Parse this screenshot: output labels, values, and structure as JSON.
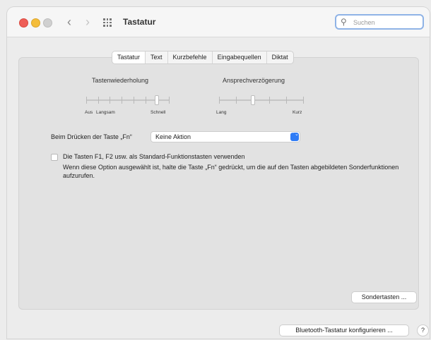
{
  "window": {
    "title": "Tastatur",
    "search_placeholder": "Suchen",
    "nav_back": "‹",
    "nav_forward": "›"
  },
  "tabs": [
    {
      "label": "Tastatur",
      "active": true
    },
    {
      "label": "Text",
      "active": false
    },
    {
      "label": "Kurzbefehle",
      "active": false
    },
    {
      "label": "Eingabequellen",
      "active": false
    },
    {
      "label": "Diktat",
      "active": false
    }
  ],
  "key_repeat": {
    "title": "Tastenwiederholung",
    "left_caption_1": "Aus",
    "left_caption_2": "Langsam",
    "right_caption": "Schnell",
    "value_step": 6,
    "steps": 8
  },
  "delay_until_repeat": {
    "title": "Ansprechverzögerung",
    "left_caption": "Lang",
    "right_caption": "Kurz",
    "value_step": 2,
    "steps": 6
  },
  "fn_key": {
    "label": "Beim Drücken der Taste „Fn“",
    "selected": "Keine Aktion",
    "arrows": "⌃⌄"
  },
  "function_keys": {
    "checked": false,
    "label": "Die Tasten F1, F2 usw. als Standard-Funktionstasten verwenden",
    "description": "Wenn diese Option ausgewählt ist, halte die Taste „Fn“ gedrückt, um die auf den Tasten abgebildeten Sonderfunktionen aufzurufen."
  },
  "buttons": {
    "modifier_keys": "Sondertasten ...",
    "bluetooth": "Bluetooth-Tastatur konfigurieren ...",
    "help": "?"
  },
  "colors": {
    "close": "#ee5e57",
    "minimize": "#f4bd3b",
    "accent": "#2f7cf6"
  }
}
